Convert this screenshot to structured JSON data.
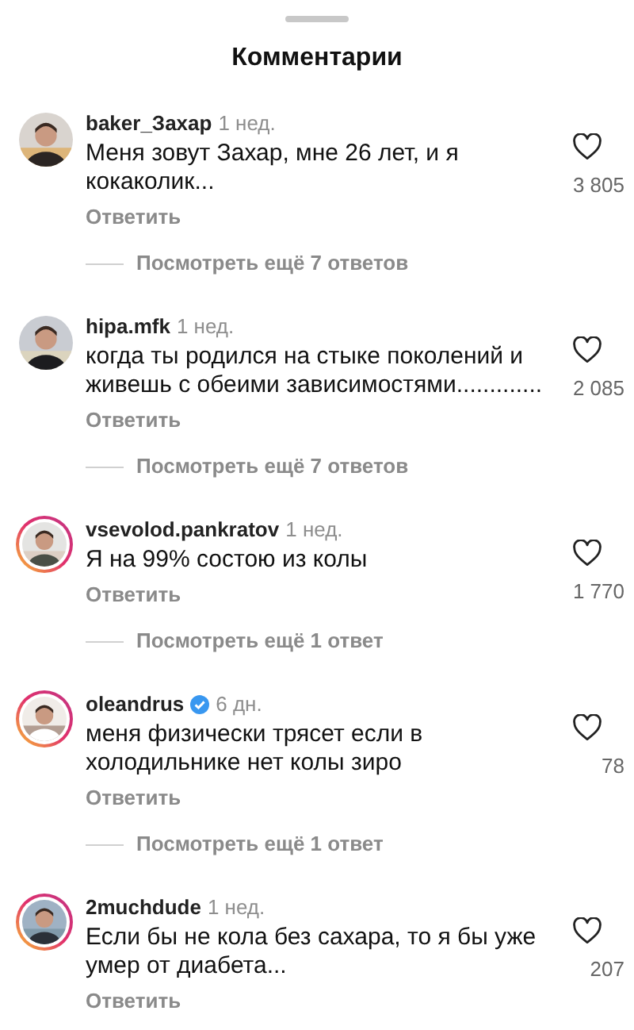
{
  "header": {
    "title": "Комментарии"
  },
  "comments": [
    {
      "username": "baker_Захар",
      "verified": false,
      "story_ring": false,
      "time": "1 нед.",
      "text": "Меня зовут Захар, мне 26 лет, и я кокаколик...",
      "likes": "3 805",
      "reply": "Ответить",
      "more_replies": "Посмотреть ещё 7 ответов"
    },
    {
      "username": "hipa.mfk",
      "verified": false,
      "story_ring": false,
      "time": "1 нед.",
      "text": "когда ты родился на стыке поколений и живешь с обеими зависимостями.............",
      "likes": "2 085",
      "reply": "Ответить",
      "more_replies": "Посмотреть ещё 7 ответов"
    },
    {
      "username": "vsevolod.pankratov",
      "verified": false,
      "story_ring": true,
      "time": "1 нед.",
      "text": "Я на 99% состою из колы",
      "likes": "1 770",
      "reply": "Ответить",
      "more_replies": "Посмотреть ещё 1 ответ"
    },
    {
      "username": "oleandrus",
      "verified": true,
      "story_ring": true,
      "time": "6 дн.",
      "text": "меня физически трясет если в холодильнике нет колы зиро",
      "likes": "78",
      "reply": "Ответить",
      "more_replies": "Посмотреть ещё 1 ответ"
    },
    {
      "username": "2muchdude",
      "verified": false,
      "story_ring": true,
      "time": "1 нед.",
      "text": "Если бы не кола без сахара, то я бы уже умер от диабета...",
      "likes": "207",
      "reply": "Ответить"
    }
  ]
}
